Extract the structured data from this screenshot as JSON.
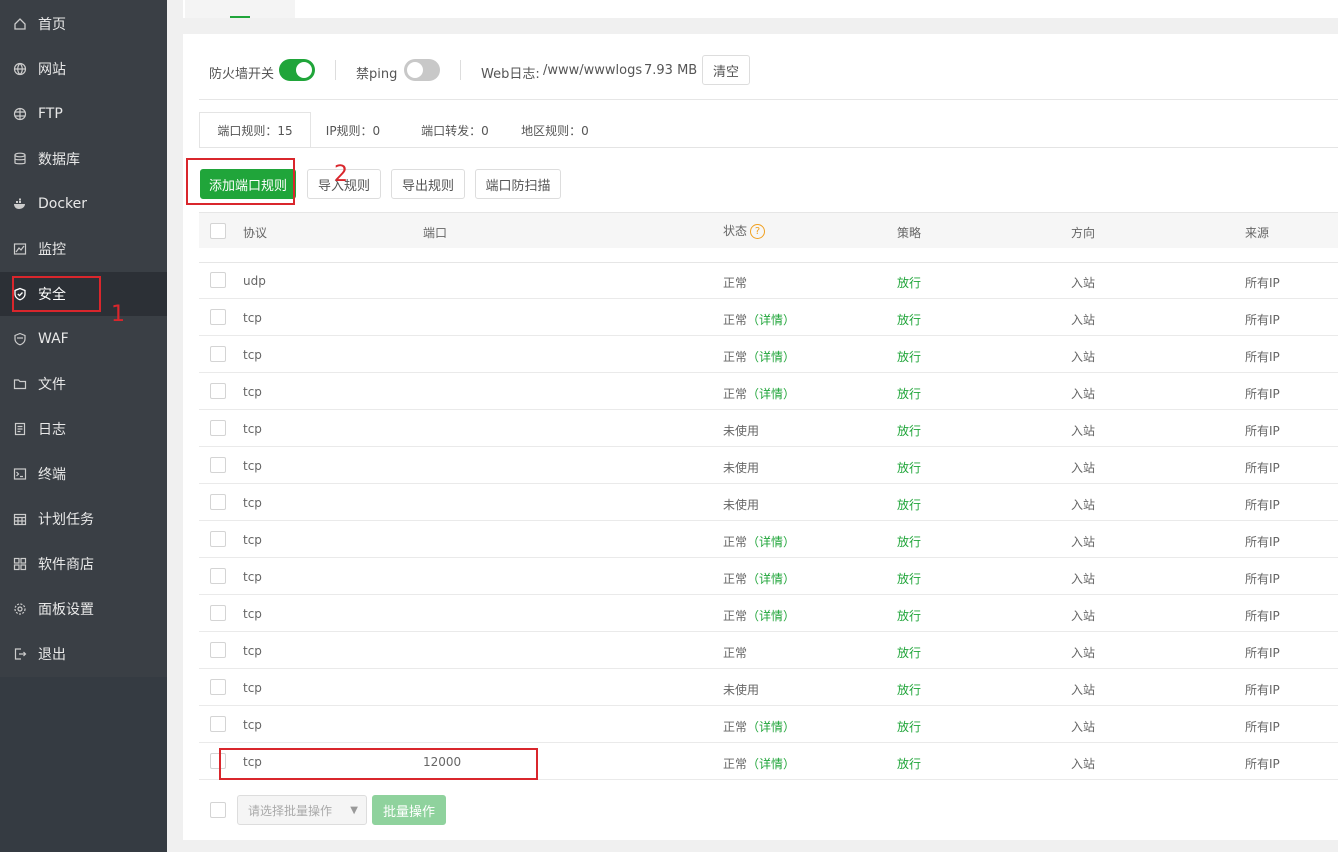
{
  "sidebar": {
    "items": [
      {
        "label": "首页",
        "icon": "home-icon"
      },
      {
        "label": "网站",
        "icon": "globe-icon"
      },
      {
        "label": "FTP",
        "icon": "ftp-globe-icon"
      },
      {
        "label": "数据库",
        "icon": "database-icon"
      },
      {
        "label": "Docker",
        "icon": "docker-icon"
      },
      {
        "label": "监控",
        "icon": "monitor-icon"
      },
      {
        "label": "安全",
        "icon": "shield-icon"
      },
      {
        "label": "WAF",
        "icon": "waf-icon"
      },
      {
        "label": "文件",
        "icon": "folder-icon"
      },
      {
        "label": "日志",
        "icon": "log-icon"
      },
      {
        "label": "终端",
        "icon": "terminal-icon"
      },
      {
        "label": "计划任务",
        "icon": "calendar-icon"
      },
      {
        "label": "软件商店",
        "icon": "apps-icon"
      },
      {
        "label": "面板设置",
        "icon": "gear-icon"
      },
      {
        "label": "退出",
        "icon": "logout-icon"
      }
    ],
    "active": "安全"
  },
  "firewall": {
    "switch_label": "防火墙开关",
    "switch_on": true,
    "ping_label": "禁ping",
    "ping_on": false,
    "weblog_label": "Web日志:",
    "weblog_path": "/www/wwwlogs",
    "weblog_size": "7.93 MB",
    "clear_label": "清空"
  },
  "tabs": [
    {
      "label": "端口规则：15",
      "active": true
    },
    {
      "label": "IP规则：0",
      "active": false
    },
    {
      "label": "端口转发：0",
      "active": false
    },
    {
      "label": "地区规则：0",
      "active": false
    }
  ],
  "actions": {
    "add": "添加端口规则",
    "import": "导入规则",
    "export": "导出规则",
    "scan": "端口防扫描"
  },
  "table": {
    "headers": {
      "protocol": "协议",
      "port": "端口",
      "status": "状态",
      "policy": "策略",
      "direction": "方向",
      "source": "来源"
    },
    "rows": [
      {
        "protocol": "udp",
        "port": "",
        "status": "正常",
        "detail": "",
        "policy": "放行",
        "direction": "入站",
        "source": "所有IP"
      },
      {
        "protocol": "tcp",
        "port": "",
        "status": "正常",
        "detail": "（详情）",
        "policy": "放行",
        "direction": "入站",
        "source": "所有IP"
      },
      {
        "protocol": "tcp",
        "port": "",
        "status": "正常",
        "detail": "（详情）",
        "policy": "放行",
        "direction": "入站",
        "source": "所有IP"
      },
      {
        "protocol": "tcp",
        "port": "",
        "status": "正常",
        "detail": "（详情）",
        "policy": "放行",
        "direction": "入站",
        "source": "所有IP"
      },
      {
        "protocol": "tcp",
        "port": "",
        "status": "未使用",
        "detail": "",
        "policy": "放行",
        "direction": "入站",
        "source": "所有IP"
      },
      {
        "protocol": "tcp",
        "port": "",
        "status": "未使用",
        "detail": "",
        "policy": "放行",
        "direction": "入站",
        "source": "所有IP"
      },
      {
        "protocol": "tcp",
        "port": "",
        "status": "未使用",
        "detail": "",
        "policy": "放行",
        "direction": "入站",
        "source": "所有IP"
      },
      {
        "protocol": "tcp",
        "port": "",
        "status": "正常",
        "detail": "（详情）",
        "policy": "放行",
        "direction": "入站",
        "source": "所有IP"
      },
      {
        "protocol": "tcp",
        "port": "",
        "status": "正常",
        "detail": "（详情）",
        "policy": "放行",
        "direction": "入站",
        "source": "所有IP"
      },
      {
        "protocol": "tcp",
        "port": "",
        "status": "正常",
        "detail": "（详情）",
        "policy": "放行",
        "direction": "入站",
        "source": "所有IP"
      },
      {
        "protocol": "tcp",
        "port": "",
        "status": "正常",
        "detail": "",
        "policy": "放行",
        "direction": "入站",
        "source": "所有IP"
      },
      {
        "protocol": "tcp",
        "port": "",
        "status": "未使用",
        "detail": "",
        "policy": "放行",
        "direction": "入站",
        "source": "所有IP"
      },
      {
        "protocol": "tcp",
        "port": "",
        "status": "正常",
        "detail": "（详情）",
        "policy": "放行",
        "direction": "入站",
        "source": "所有IP"
      },
      {
        "protocol": "tcp",
        "port": "12000",
        "status": "正常",
        "detail": "（详情）",
        "policy": "放行",
        "direction": "入站",
        "source": "所有IP"
      }
    ]
  },
  "batch": {
    "select_placeholder": "请选择批量操作",
    "button": "批量操作"
  },
  "annotations": {
    "one": "1",
    "two": "2"
  },
  "colors": {
    "accent": "#20a53a",
    "sidebar": "#3a3f45",
    "annotation": "#d9262c"
  }
}
